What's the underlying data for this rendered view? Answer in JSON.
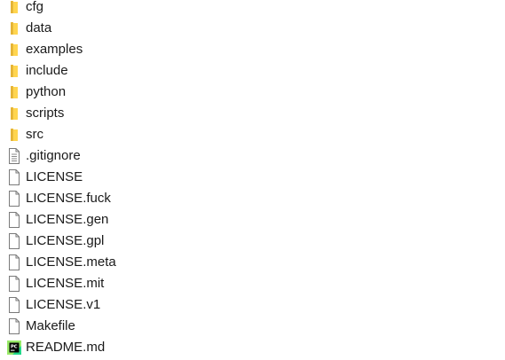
{
  "file_list": {
    "items": [
      {
        "name": "cfg",
        "type": "folder",
        "icon": "folder-icon"
      },
      {
        "name": "data",
        "type": "folder",
        "icon": "folder-icon"
      },
      {
        "name": "examples",
        "type": "folder",
        "icon": "folder-icon"
      },
      {
        "name": "include",
        "type": "folder",
        "icon": "folder-icon"
      },
      {
        "name": "python",
        "type": "folder",
        "icon": "folder-icon"
      },
      {
        "name": "scripts",
        "type": "folder",
        "icon": "folder-icon"
      },
      {
        "name": "src",
        "type": "folder",
        "icon": "folder-icon"
      },
      {
        "name": ".gitignore",
        "type": "file",
        "icon": "text-file-icon"
      },
      {
        "name": "LICENSE",
        "type": "file",
        "icon": "blank-file-icon"
      },
      {
        "name": "LICENSE.fuck",
        "type": "file",
        "icon": "blank-file-icon"
      },
      {
        "name": "LICENSE.gen",
        "type": "file",
        "icon": "blank-file-icon"
      },
      {
        "name": "LICENSE.gpl",
        "type": "file",
        "icon": "blank-file-icon"
      },
      {
        "name": "LICENSE.meta",
        "type": "file",
        "icon": "blank-file-icon"
      },
      {
        "name": "LICENSE.mit",
        "type": "file",
        "icon": "blank-file-icon"
      },
      {
        "name": "LICENSE.v1",
        "type": "file",
        "icon": "blank-file-icon"
      },
      {
        "name": "Makefile",
        "type": "file",
        "icon": "blank-file-icon"
      },
      {
        "name": "README.md",
        "type": "file",
        "icon": "pycharm-file-icon",
        "icon_text": "PC"
      }
    ]
  },
  "colors": {
    "folder_front": "#ffd54f",
    "folder_back": "#e8b83a",
    "file_border": "#7a7a7a",
    "file_lines": "#8a8a8a",
    "pycharm_green": "#21d789",
    "pycharm_dark": "#000000",
    "text": "#1a1a1a"
  }
}
